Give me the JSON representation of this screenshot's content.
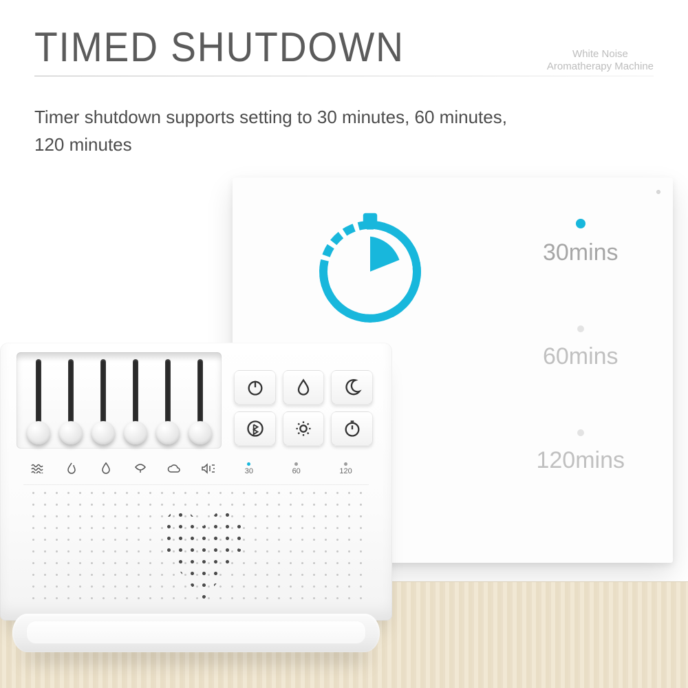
{
  "header": {
    "title": "TIMED SHUTDOWN",
    "brand_line1": "White Noise",
    "brand_line2": "Aromatherapy Machine"
  },
  "description": "Timer shutdown supports setting to 30 minutes, 60 minutes, 120 minutes",
  "panel": {
    "options": [
      {
        "label": "30mins",
        "active": true
      },
      {
        "label": "60mins",
        "active": false
      },
      {
        "label": "120mins",
        "active": false
      }
    ]
  },
  "device": {
    "timer_labels": [
      "30",
      "60",
      "120"
    ],
    "buttons": [
      "power",
      "mist",
      "night",
      "bluetooth",
      "light",
      "timer"
    ],
    "slider_icons": [
      "wave",
      "flame",
      "rain",
      "leaf",
      "cloud",
      "volume"
    ]
  },
  "colors": {
    "accent": "#18b7dc"
  }
}
